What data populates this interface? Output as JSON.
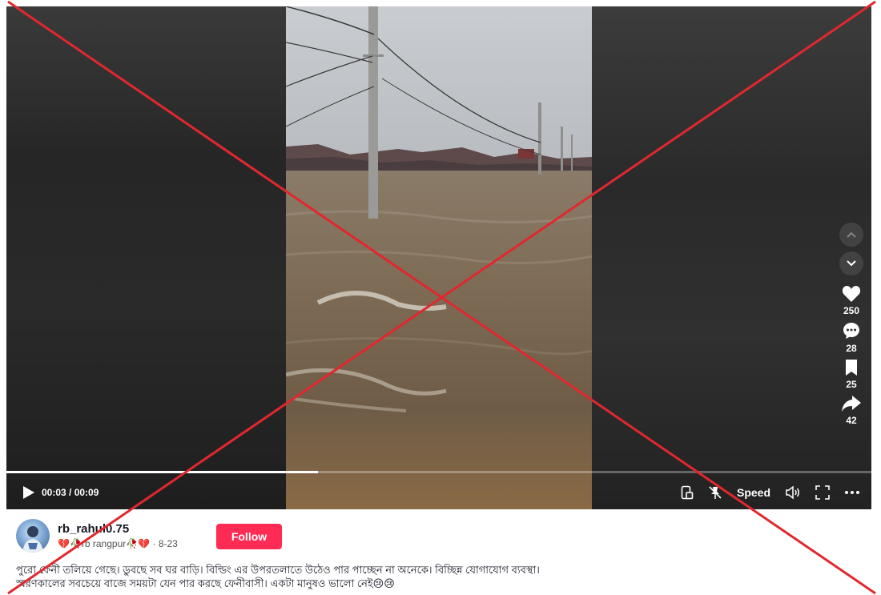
{
  "player": {
    "progress_fraction": 0.36,
    "time": "00:03 / 00:09",
    "speed_label": "Speed"
  },
  "actions": {
    "likes": "250",
    "comments": "28",
    "saves": "25",
    "shares": "42"
  },
  "post": {
    "username": "rb_rahul0.75",
    "subline_prefix": "💔🥀rb rangpur🥀💔",
    "date": "8-23",
    "follow_label": "Follow",
    "caption_line1": "পুরো ফেনী তলিয়ে গেছে। ডুবছে সব ঘর বাড়ি। বিল্ডিং এর উপরতলাতে উঠেও পার পাচ্ছেন না অনেকে। বিচ্ছিন্ন যোগাযোগ ব্যবস্থা।",
    "caption_line2": "স্মরণকালের সবচেয়ে বাজে সময়টা যেন পার করছে ফেনীবাসী। একটা মানুষও ভালো নেই😢😢"
  },
  "colors": {
    "follow_bg": "#fe2c55",
    "cross_red": "#e0282e"
  }
}
